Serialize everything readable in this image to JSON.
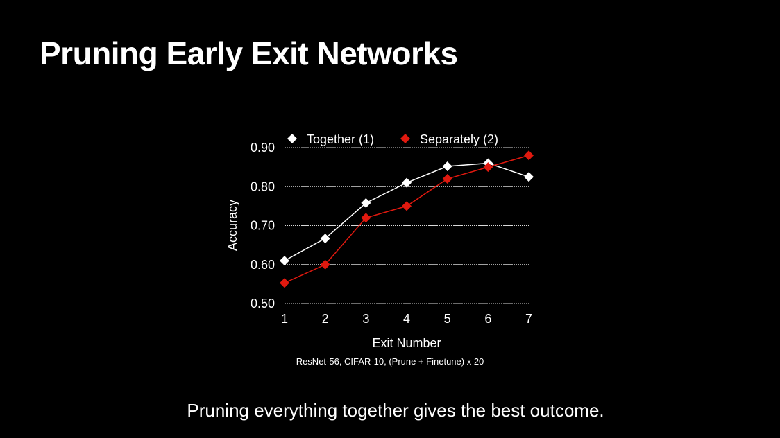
{
  "slide": {
    "title": "Pruning Early Exit Networks",
    "caption": "ResNet-56, CIFAR-10, (Prune + Finetune) x 20",
    "footer": "Pruning everything together gives the best outcome."
  },
  "chart_data": {
    "type": "line",
    "xlabel": "Exit Number",
    "ylabel": "Accuracy",
    "x": [
      1,
      2,
      3,
      4,
      5,
      6,
      7
    ],
    "xticks": [
      "1",
      "2",
      "3",
      "4",
      "5",
      "6",
      "7"
    ],
    "yticks": [
      "0.50",
      "0.60",
      "0.70",
      "0.80",
      "0.90"
    ],
    "ylim": [
      0.5,
      0.9
    ],
    "xlim": [
      1,
      7
    ],
    "grid": true,
    "legend_position": "top",
    "series": [
      {
        "name": "Together (1)",
        "color": "#ffffff",
        "values": [
          0.61,
          0.667,
          0.758,
          0.81,
          0.852,
          0.86,
          0.825
        ]
      },
      {
        "name": "Separately (2)",
        "color": "#e0190f",
        "values": [
          0.553,
          0.6,
          0.72,
          0.75,
          0.82,
          0.85,
          0.88
        ]
      }
    ],
    "marker": "diamond"
  }
}
